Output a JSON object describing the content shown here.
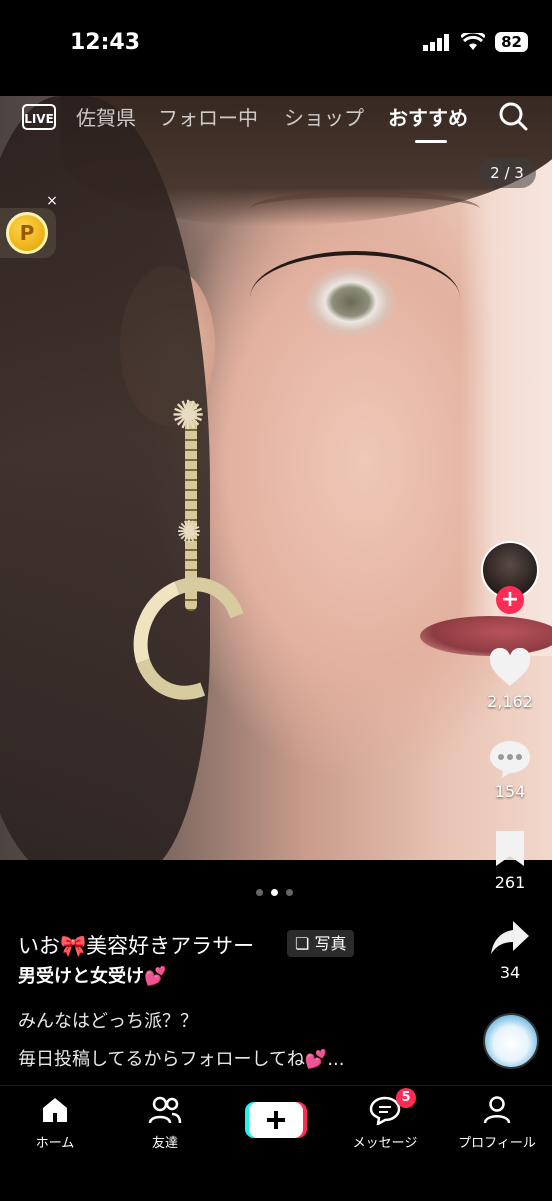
{
  "status": {
    "time": "12:43",
    "battery": "82"
  },
  "top_nav": {
    "live_label": "LIVE",
    "tabs": [
      {
        "label": "佐賀県",
        "active": false
      },
      {
        "label": "フォロー中",
        "active": false
      },
      {
        "label": "ショップ",
        "active": false
      },
      {
        "label": "おすすめ",
        "active": true
      }
    ]
  },
  "photo": {
    "counter": "2 / 3"
  },
  "coin": {
    "label": "P",
    "close": "×"
  },
  "rail": {
    "likes": "2,162",
    "comments": "154",
    "saves": "261",
    "shares": "34"
  },
  "carousel": {
    "total": 3,
    "current": 2
  },
  "post": {
    "username": "いお🎀美容好きアラサー",
    "type_badge": "写真",
    "title": "男受けと女受け💕",
    "caption_line1": "みんなはどっち派？？",
    "caption_line2": "毎日投稿してるからフォローしてね💕..."
  },
  "bottom_nav": {
    "home": "ホーム",
    "friends": "友達",
    "messages": "メッセージ",
    "messages_badge": "5",
    "profile": "プロフィール"
  },
  "colors": {
    "accent": "#fe2c55",
    "background": "#000000"
  },
  "icons": [
    "live-icon",
    "search-icon",
    "coin-icon",
    "heart-icon",
    "comment-icon",
    "bookmark-icon",
    "share-icon",
    "home-icon",
    "friends-icon",
    "plus-icon",
    "message-icon",
    "profile-icon"
  ]
}
